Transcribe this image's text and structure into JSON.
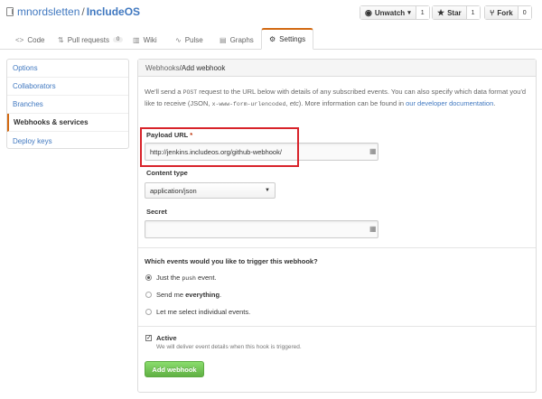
{
  "repo": {
    "owner": "mnordsletten",
    "separator": "/",
    "name": "IncludeOS"
  },
  "actions": [
    {
      "label": "Unwatch",
      "icon": "eye-icon",
      "caret": "▾",
      "count": "1"
    },
    {
      "label": "Star",
      "icon": "star-icon",
      "count": "1"
    },
    {
      "label": "Fork",
      "icon": "fork-icon",
      "count": "0"
    }
  ],
  "tabs": [
    {
      "label": "Code",
      "icon": "code-icon"
    },
    {
      "label": "Pull requests",
      "icon": "pull-request-icon",
      "count": "0"
    },
    {
      "label": "Wiki",
      "icon": "book-icon"
    },
    {
      "label": "Pulse",
      "icon": "pulse-icon"
    },
    {
      "label": "Graphs",
      "icon": "graph-icon"
    },
    {
      "label": "Settings",
      "icon": "gear-icon",
      "selected": true
    }
  ],
  "sidebar": {
    "items": [
      {
        "label": "Options"
      },
      {
        "label": "Collaborators"
      },
      {
        "label": "Branches"
      },
      {
        "label": "Webhooks & services",
        "selected": true
      },
      {
        "label": "Deploy keys"
      }
    ]
  },
  "panel": {
    "breadcrumb_parent": "Webhooks",
    "breadcrumb_sep": " / ",
    "title": "Add webhook",
    "intro_1": "We'll send a ",
    "intro_post": "POST",
    "intro_2": " request to the URL below with details of any subscribed events. You can also specify which data format you'd like to receive (JSON, ",
    "intro_form": "x-www-form-urlencoded",
    "intro_3": ", ",
    "intro_etc": "etc",
    "intro_4": "). More information can be found in ",
    "intro_link": "our developer documentation",
    "intro_5": "."
  },
  "form": {
    "payload_label": "Payload URL",
    "payload_required": "*",
    "payload_value": "http://jenkins.includeos.org/github-webhook/",
    "content_type_label": "Content type",
    "content_type_value": "application/json",
    "secret_label": "Secret",
    "secret_value": "",
    "events_question": "Which events would you like to trigger this webhook?",
    "events": [
      {
        "pre": "Just the ",
        "code": "push",
        "post": " event.",
        "checked": true
      },
      {
        "pre": "Send me ",
        "bold": "everything",
        "post": ".",
        "checked": false
      },
      {
        "pre": "Let me select individual events.",
        "checked": false
      }
    ],
    "active_label": "Active",
    "active_checked": true,
    "active_note": "We will deliver event details when this hook is triggered.",
    "submit_label": "Add webhook"
  },
  "colors": {
    "link": "#4078c0",
    "accent_tab": "#d26911",
    "highlight_box": "#d8232a",
    "button_green": "#60b044"
  }
}
